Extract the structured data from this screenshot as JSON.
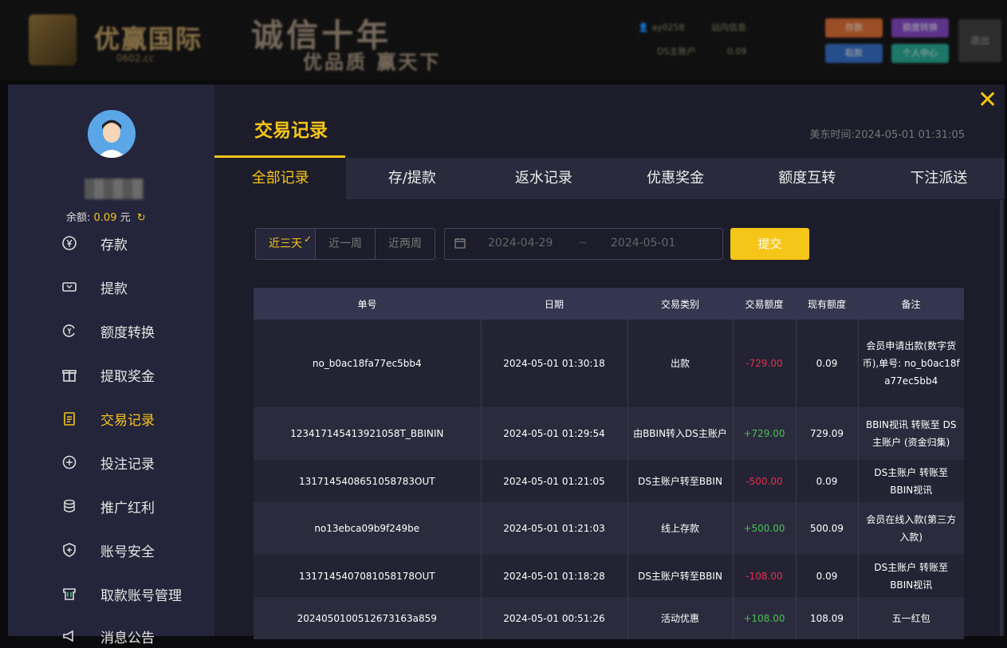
{
  "bg_header": {
    "logo_name": "优赢国际",
    "logo_domain": "0602.cc",
    "slogan_line1": "诚信十年",
    "slogan_line2": "优品质 赢天下",
    "user": "ay0258",
    "inbox": "站内信息",
    "wallet": "DS主账户",
    "wallet_balance": "0.09",
    "btn_deposit": "存款",
    "btn_transfer": "额度转换",
    "btn_withdraw": "取款",
    "btn_center": "个人中心",
    "btn_logout": "退出"
  },
  "sidebar": {
    "balance_label": "余额:",
    "balance_value": "0.09",
    "balance_unit": "元",
    "items": [
      {
        "label": "存款",
        "icon": "yen-circle-icon"
      },
      {
        "label": "提款",
        "icon": "ticket-icon"
      },
      {
        "label": "额度转换",
        "icon": "exchange-icon"
      },
      {
        "label": "提取奖金",
        "icon": "gift-icon"
      },
      {
        "label": "交易记录",
        "icon": "clipboard-icon"
      },
      {
        "label": "投注记录",
        "icon": "bet-icon"
      },
      {
        "label": "推广红利",
        "icon": "coins-icon"
      },
      {
        "label": "账号安全",
        "icon": "shield-icon"
      },
      {
        "label": "取款账号管理",
        "icon": "card-icon"
      },
      {
        "label": "消息公告",
        "icon": "megaphone-icon"
      }
    ]
  },
  "main": {
    "title": "交易记录",
    "time_label": "美东时间:",
    "time_value": "2024-05-01 01:31:05",
    "close": "✕",
    "tabs": [
      "全部记录",
      "存/提款",
      "返水记录",
      "优惠奖金",
      "额度互转",
      "下注派送"
    ],
    "range": [
      "近三天",
      "近一周",
      "近两周"
    ],
    "date_from": "2024-04-29",
    "date_sep": "~",
    "date_to": "2024-05-01",
    "submit": "提交",
    "columns": [
      "单号",
      "日期",
      "交易类别",
      "交易额度",
      "现有额度",
      "备注"
    ],
    "rows": [
      {
        "id": "no_b0ac18fa77ec5bb4",
        "date": "2024-05-01 01:30:18",
        "type": "出款",
        "amount": "-729.00",
        "balance": "0.09",
        "note": "会员申请出款(数字货币),单号: no_b0ac18fa77ec5bb4"
      },
      {
        "id": "123417145413921058T_BBININ",
        "date": "2024-05-01 01:29:54",
        "type": "由BBIN转入DS主账户",
        "amount": "+729.00",
        "balance": "729.09",
        "note": "BBIN视讯 转账至 DS主账户 (资金归集)"
      },
      {
        "id": "1317145408651058783OUT",
        "date": "2024-05-01 01:21:05",
        "type": "DS主账户转至BBIN",
        "amount": "-500.00",
        "balance": "0.09",
        "note": "DS主账户 转账至 BBIN视讯"
      },
      {
        "id": "no13ebca09b9f249be",
        "date": "2024-05-01 01:21:03",
        "type": "线上存款",
        "amount": "+500.00",
        "balance": "500.09",
        "note": "会员在线入款(第三方入款)"
      },
      {
        "id": "1317145407081058178OUT",
        "date": "2024-05-01 01:18:28",
        "type": "DS主账户转至BBIN",
        "amount": "-108.00",
        "balance": "0.09",
        "note": "DS主账户 转账至 BBIN视讯"
      },
      {
        "id": "20240501005126731​63a859",
        "date": "2024-05-01 00:51:26",
        "type": "活动优惠",
        "amount": "+108.00",
        "balance": "108.09",
        "note": "五一红包"
      }
    ]
  }
}
